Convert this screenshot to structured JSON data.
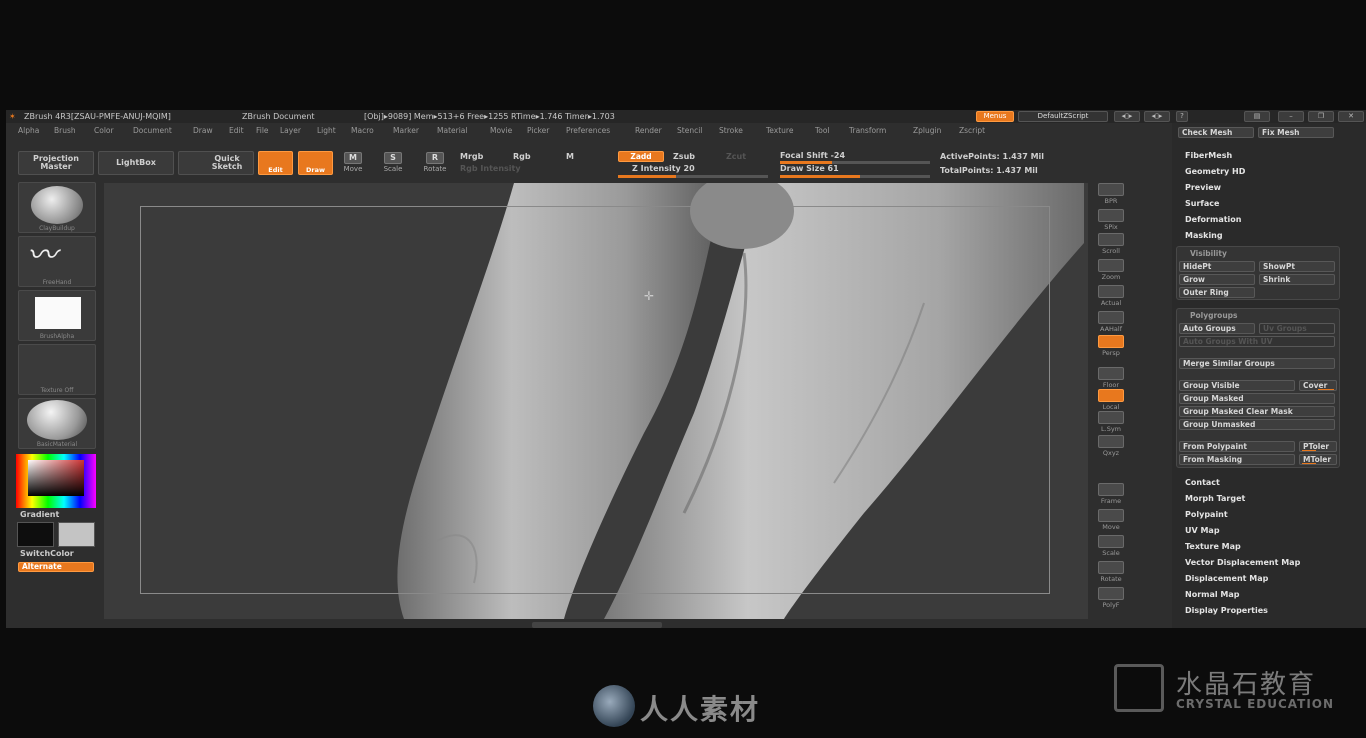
{
  "titlebar": {
    "app": "ZBrush 4R3[ZSAU-PMFE-ANUJ-MQIM]",
    "document": "ZBrush Document",
    "stats": "[Obj]▸9089] Mem▸513+6 Free▸1255 RTime▸1.746 Timer▸1.703",
    "menus_btn": "Menus",
    "script_btn": "DefaultZScript"
  },
  "menubar": [
    "Alpha",
    "Brush",
    "Color",
    "Document",
    "Draw",
    "Edit",
    "File",
    "Layer",
    "Light",
    "Macro",
    "Marker",
    "Material",
    "Movie",
    "Picker",
    "Preferences",
    "Render",
    "Stencil",
    "Stroke",
    "Texture",
    "Tool",
    "Transform",
    "Zplugin",
    "Zscript"
  ],
  "toolbar": {
    "projection_master": "Projection Master",
    "lightbox": "LightBox",
    "quick_sketch": "Quick Sketch",
    "edit": "Edit",
    "draw": "Draw",
    "move": "Move",
    "scale": "Scale",
    "rotate": "Rotate",
    "mrgb": "Mrgb",
    "rgb": "Rgb",
    "m": "M",
    "rgb_intensity": "Rgb Intensity",
    "zadd": "Zadd",
    "zsub": "Zsub",
    "zcut": "Zcut",
    "z_intensity": "Z Intensity 20",
    "focal_shift": "Focal Shift -24",
    "draw_size": "Draw Size 61",
    "active_points": "ActivePoints: 1.437 Mil",
    "total_points": "TotalPoints: 1.437 Mil"
  },
  "leftshelf": {
    "brush": "ClayBuildup",
    "stroke": "FreeHand",
    "alpha": "BrushAlpha",
    "texture": "Texture Off",
    "material": "BasicMaterial",
    "gradient": "Gradient",
    "switchcolor": "SwitchColor",
    "alternate": "Alternate"
  },
  "rightshelf": [
    "BPR",
    "SPix",
    "Scroll",
    "Zoom",
    "Actual",
    "AAHalf",
    "Persp",
    "Floor",
    "Local",
    "L.Sym",
    "Qxyz",
    "Frame",
    "Move",
    "Scale",
    "Rotate",
    "PolyF"
  ],
  "panel": {
    "check_mesh": "Check Mesh",
    "fix_mesh": "Fix Mesh",
    "items_top": [
      "FiberMesh",
      "Geometry HD",
      "Preview",
      "Surface",
      "Deformation",
      "Masking"
    ],
    "visibility": {
      "title": "Visibility",
      "hidept": "HidePt",
      "showpt": "ShowPt",
      "grow": "Grow",
      "shrink": "Shrink",
      "outer_ring": "Outer Ring"
    },
    "polygroups": {
      "title": "Polygroups",
      "auto_groups": "Auto Groups",
      "uv_groups": "Uv Groups",
      "auto_groups_uv": "Auto Groups With UV",
      "merge_similar": "Merge Similar Groups",
      "group_visible": "Group Visible",
      "coverage": "Cover",
      "group_masked": "Group Masked",
      "group_masked_clear": "Group Masked Clear Mask",
      "group_unmasked": "Group Unmasked",
      "from_polypaint": "From Polypaint",
      "ptoler": "PToler",
      "from_masking": "From Masking",
      "mtoler": "MToler"
    },
    "items_bottom": [
      "Contact",
      "Morph Target",
      "Polypaint",
      "UV Map",
      "Texture Map",
      "Vector Displacement Map",
      "Displacement Map",
      "Normal Map",
      "Display Properties"
    ]
  },
  "watermarks": {
    "cn_brand": "水晶石教育",
    "en_brand": "CRYSTAL EDUCATION",
    "site": "人人素材"
  }
}
